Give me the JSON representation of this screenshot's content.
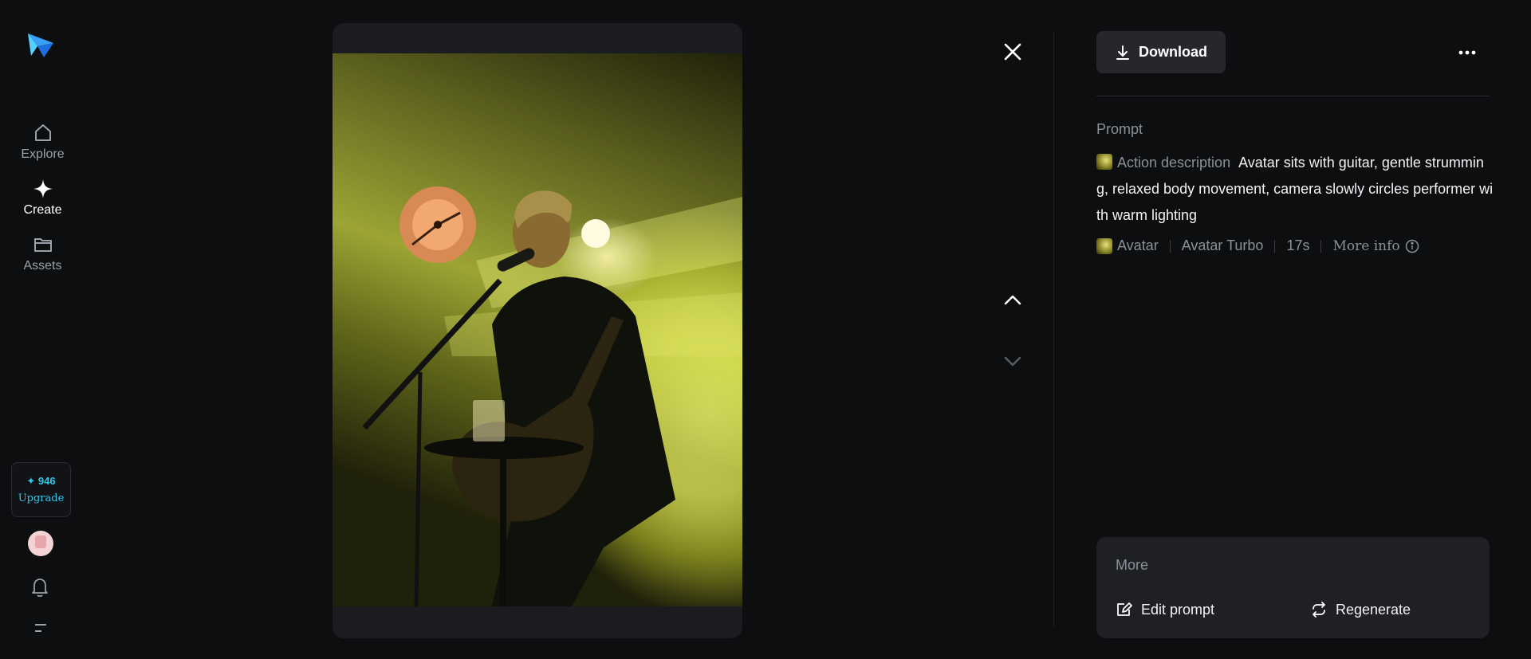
{
  "sidebar": {
    "nav": [
      {
        "label": "Explore",
        "icon": "home-icon"
      },
      {
        "label": "Create",
        "icon": "sparkle-icon",
        "active": true
      },
      {
        "label": "Assets",
        "icon": "folder-icon"
      }
    ],
    "credits": {
      "count": "✦ 946",
      "upgrade": "Upgrade"
    }
  },
  "viewer": {
    "close_icon": "close-icon",
    "prev_icon": "chevron-up-icon",
    "next_icon": "chevron-down-icon"
  },
  "panel": {
    "download_label": "Download",
    "prompt_label": "Prompt",
    "action_label": "Action description",
    "prompt_text": "Avatar sits with guitar, gentle strumming, relaxed body movement, camera slowly circles performer with warm lighting",
    "meta": {
      "model_label": "Avatar",
      "model_variant": "Avatar Turbo",
      "duration": "17s",
      "more_info": "More info"
    },
    "more": {
      "title": "More",
      "edit_prompt": "Edit prompt",
      "regenerate": "Regenerate"
    }
  },
  "colors": {
    "accent": "#2fc8e8",
    "background": "#0d0e10",
    "panel": "#1f2024"
  }
}
